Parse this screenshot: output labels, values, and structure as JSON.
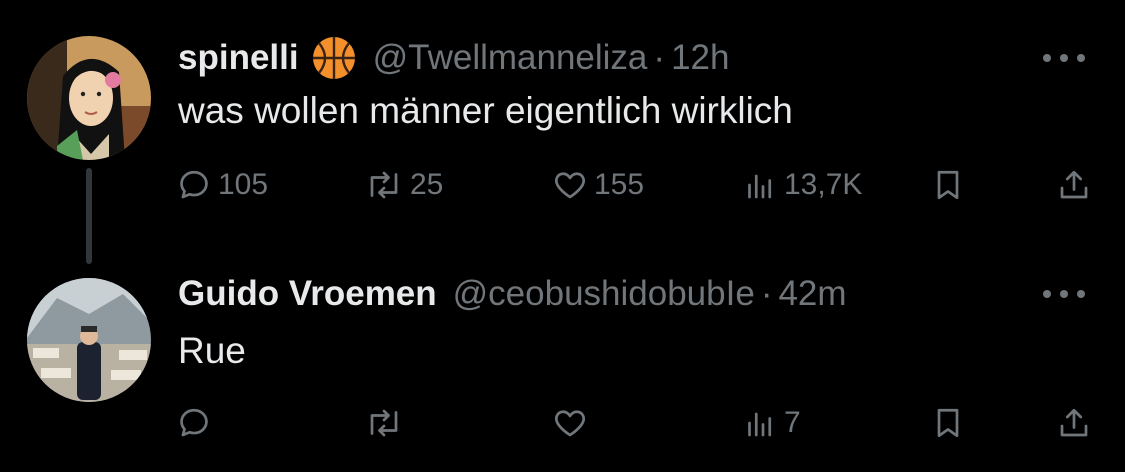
{
  "tweets": [
    {
      "display_name": "spinelli",
      "emoji": "basketball-emoji",
      "handle": "@Twellmanneliza",
      "separator": "·",
      "time": "12h",
      "text": "was wollen männer eigentlich wirklich",
      "replies": "105",
      "retweets": "25",
      "likes": "155",
      "views": "13,7K"
    },
    {
      "display_name": "Guido Vroemen",
      "handle": "@ceobushidobubIe",
      "separator": "·",
      "time": "42m",
      "text": "Rue",
      "replies": "",
      "retweets": "",
      "likes": "",
      "views": "7"
    }
  ],
  "colors": {
    "background": "#000000",
    "text_primary": "#e7e9ea",
    "text_secondary": "#71767b",
    "thread_line": "#333639"
  }
}
